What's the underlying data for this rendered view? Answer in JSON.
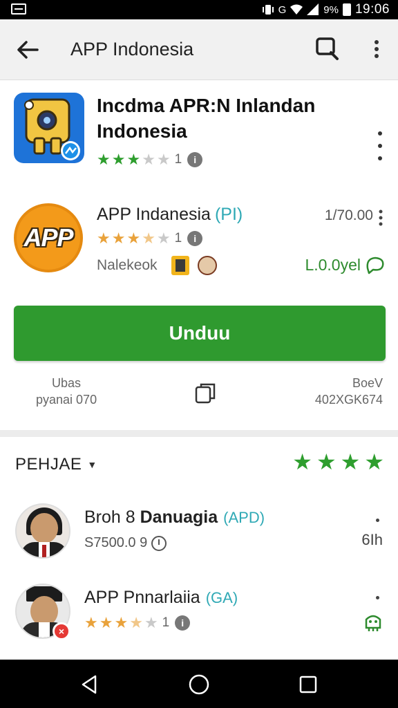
{
  "status_bar": {
    "signal_text": "G",
    "battery_text": "9%",
    "time": "19:06"
  },
  "toolbar": {
    "back_icon": "arrow-left-icon",
    "title": "APP Indonesia",
    "search_icon": "search-icon",
    "more_icon": "more-vert-icon"
  },
  "app_primary": {
    "title": "Incdma APR:N Inlandan Indonesia",
    "rating_stars_filled": 3.5,
    "rating_count": "1",
    "icon_color": "#1e73d8"
  },
  "app_secondary": {
    "name": "APP Indanesia",
    "tag": "(PI)",
    "price": "1/70.00",
    "rating_stars_filled": 3.5,
    "rating_count": "1",
    "icon_text": "APP",
    "developer": "Nalekeok",
    "install_text": "L.0.0yel"
  },
  "install_button": {
    "label": "Unduu",
    "color": "#2f9a2f"
  },
  "meta": {
    "left_line1": "Ubas",
    "left_line2": "pyanai 070",
    "right_line1": "BoeV",
    "right_line2": "402XGK674"
  },
  "reviews": {
    "header": "PEHJAE",
    "overall_stars": 4,
    "items": [
      {
        "name_prefix": "Broh 8 ",
        "name_bold": "Danuagia",
        "tag": "(APD)",
        "sub": "S7500.0 9",
        "time": "6Ih"
      },
      {
        "name_prefix": "APP Pnnarlaiia",
        "name_bold": "",
        "tag": "(GA)",
        "rating_stars_filled": 3.5,
        "rating_count": "1"
      }
    ]
  },
  "nav": {
    "back": "nav-back-icon",
    "home": "nav-home-icon",
    "recents": "nav-recents-icon"
  }
}
